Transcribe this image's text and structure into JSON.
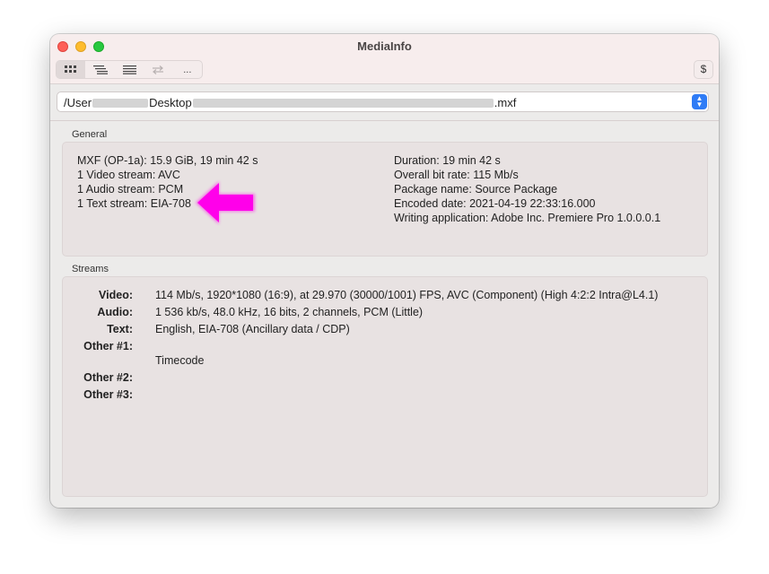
{
  "window": {
    "title": "MediaInfo"
  },
  "toolbar": {
    "buttons": [
      {
        "name": "easy-view-icon"
      },
      {
        "name": "sheet-view-icon"
      },
      {
        "name": "text-view-icon"
      },
      {
        "name": "compare-icon"
      },
      {
        "label": "..."
      }
    ],
    "donate_label": "$"
  },
  "pathbar": {
    "prefix": "/User",
    "middle": "Desktop",
    "suffix": ".mxf"
  },
  "general": {
    "label": "General",
    "left": [
      "MXF (OP-1a): 15.9 GiB, 19 min 42 s",
      "1 Video stream: AVC",
      "1 Audio stream: PCM",
      "1 Text stream: EIA-708"
    ],
    "right": [
      "Duration: 19 min 42 s",
      "Overall bit rate: 115 Mb/s",
      "Package name: Source Package",
      "Encoded date: 2021-04-19 22:33:16.000",
      "Writing application: Adobe Inc. Premiere Pro 1.0.0.0.1"
    ]
  },
  "streams": {
    "label": "Streams",
    "rows": [
      {
        "key": "Video:",
        "value": "114 Mb/s, 1920*1080 (16:9), at 29.970 (30000/1001) FPS, AVC (Component) (High 4:2:2 Intra@L4.1)"
      },
      {
        "key": "Audio:",
        "value": "1 536 kb/s, 48.0 kHz, 16 bits, 2 channels, PCM (Little)"
      },
      {
        "key": "Text:",
        "value": "English, EIA-708 (Ancillary data / CDP)"
      },
      {
        "key": "Other #1:",
        "value": ""
      },
      {
        "key": "",
        "value": "Timecode"
      },
      {
        "key": "Other #2:",
        "value": ""
      },
      {
        "key": "Other #3:",
        "value": ""
      }
    ]
  },
  "colors": {
    "annotation_arrow": "#ff00ea",
    "stepper_accent": "#2f7cf6"
  }
}
